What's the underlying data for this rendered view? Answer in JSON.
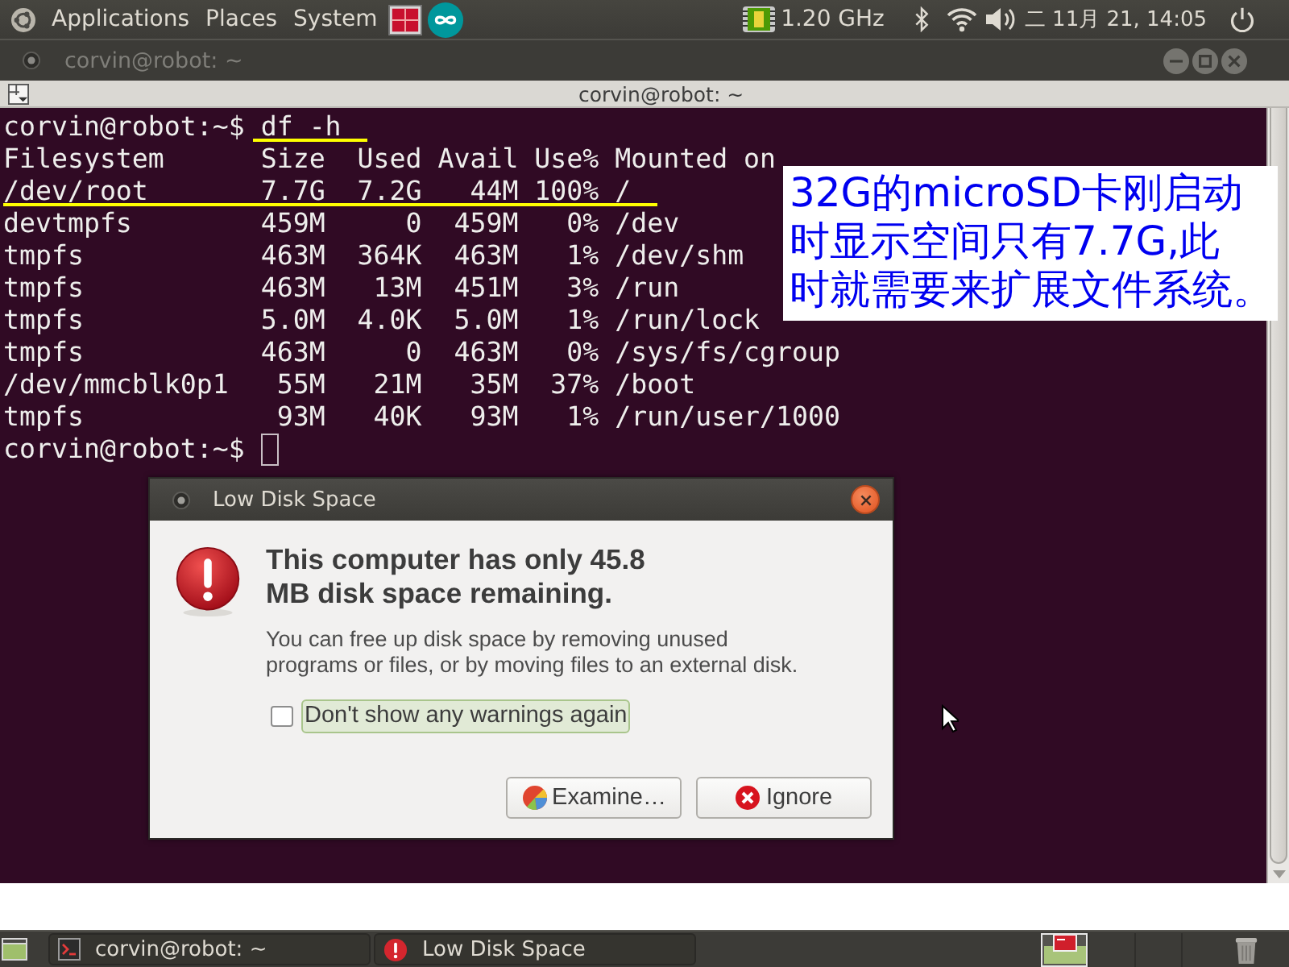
{
  "top_panel": {
    "menus": [
      "Applications",
      "Places",
      "System"
    ],
    "cpu_frequency": "1.20 GHz",
    "clock": "二 11月 21, 14:05"
  },
  "terminal_window": {
    "title": "corvin@robot: ~",
    "active": false,
    "header_title": "corvin@robot: ~",
    "lines": [
      {
        "kind": "prompt",
        "prompt": "corvin@robot:~$",
        "command": "df -h",
        "underlined": true,
        "cursor": false
      },
      {
        "kind": "output",
        "text": "Filesystem      Size  Used Avail Use% Mounted on",
        "underlined": false
      },
      {
        "kind": "output",
        "text": "/dev/root       7.7G  7.2G   44M 100% /",
        "underlined": true
      },
      {
        "kind": "output",
        "text": "devtmpfs        459M     0  459M   0% /dev",
        "underlined": false
      },
      {
        "kind": "output",
        "text": "tmpfs           463M  364K  463M   1% /dev/shm",
        "underlined": false
      },
      {
        "kind": "output",
        "text": "tmpfs           463M   13M  451M   3% /run",
        "underlined": false
      },
      {
        "kind": "output",
        "text": "tmpfs           5.0M  4.0K  5.0M   1% /run/lock",
        "underlined": false
      },
      {
        "kind": "output",
        "text": "tmpfs           463M     0  463M   0% /sys/fs/cgroup",
        "underlined": false
      },
      {
        "kind": "output",
        "text": "/dev/mmcblk0p1   55M   21M   35M  37% /boot",
        "underlined": false
      },
      {
        "kind": "output",
        "text": "tmpfs            93M   40K   93M   1% /run/user/1000",
        "underlined": false
      },
      {
        "kind": "prompt",
        "prompt": "corvin@robot:~$",
        "underlined": false,
        "cursor": true
      }
    ]
  },
  "annotation": {
    "lines": [
      "32G的microSD卡刚启动",
      "时显示空间只有7.7G,此",
      "时就需要来扩展文件系统。"
    ]
  },
  "dialog": {
    "title": "Low Disk Space",
    "heading": "This computer has only 45.8\nMB disk space remaining.",
    "message": "You can free up disk space by removing unused\nprograms or files, or by moving files to an external disk.",
    "checkbox": {
      "label": "Don't show any warnings again",
      "checked": false,
      "focused": true
    },
    "buttons": [
      {
        "label": "Examine…",
        "kind": "analyze"
      },
      {
        "label": "Ignore",
        "kind": "cancel"
      }
    ]
  },
  "bottom_panel": {
    "tasks": [
      {
        "label": "corvin@robot: ~",
        "kind": "terminal",
        "selected": false
      },
      {
        "label": "Low Disk Space",
        "kind": "alert",
        "selected": false
      }
    ],
    "workspaces": [
      {
        "selected": true,
        "has_windows": true
      },
      {
        "selected": false,
        "has_windows": false
      },
      {
        "selected": false,
        "has_windows": false
      },
      {
        "selected": false,
        "has_windows": false
      }
    ]
  }
}
